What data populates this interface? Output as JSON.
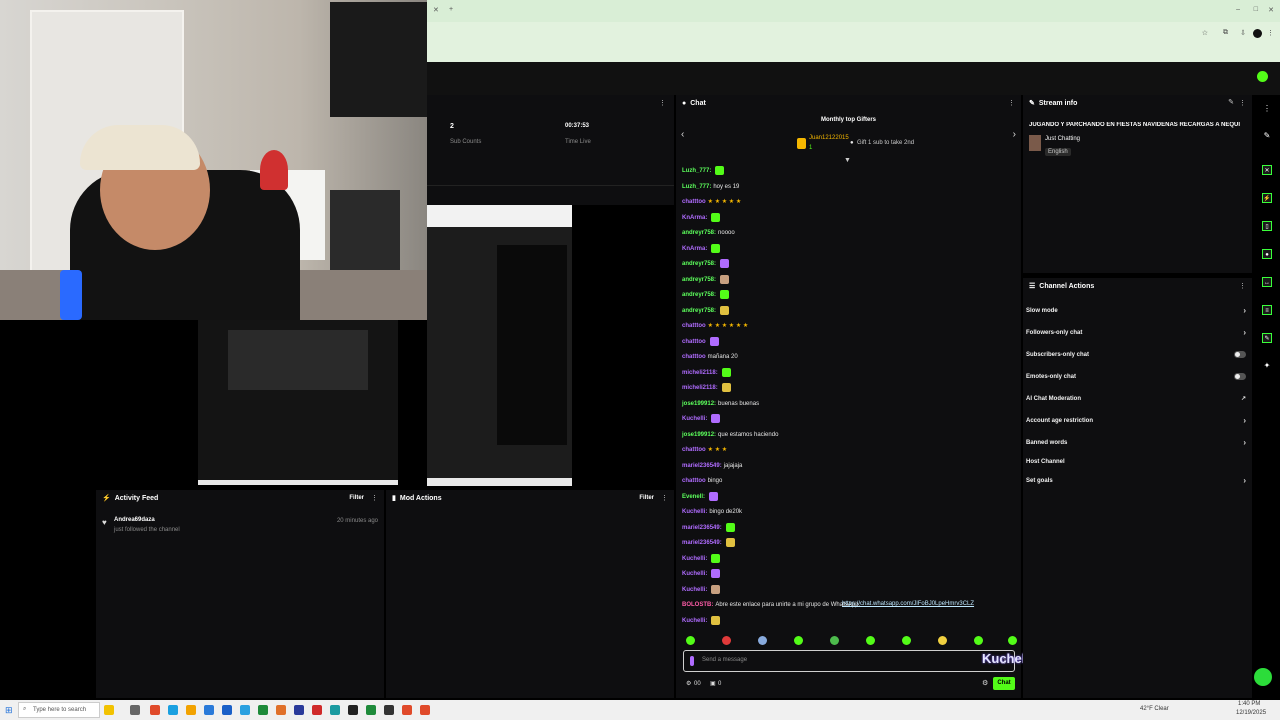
{
  "stream_stats": {
    "sub_count_value": "2",
    "sub_count_label": "Sub Counts",
    "time_value": "00:37:53",
    "time_label": "Time Live"
  },
  "chat": {
    "title": "Chat",
    "top_gifters_title": "Monthly top Gifters",
    "top_gifter_name": "Juan12122015",
    "top_gifter_count": "1",
    "gift_note": "Gift 1 sub to take 2nd",
    "messages": [
      {
        "user": "Luzh_777:",
        "text": "",
        "color": "#5cff5c"
      },
      {
        "user": "Luzh_777:",
        "text": "hoy es 19",
        "color": "#5cff5c"
      },
      {
        "user": "chatttoo",
        "text": "★ ★ ★ ★ ★",
        "color": "#b06cff"
      },
      {
        "user": "KnArma:",
        "text": "",
        "color": "#b06cff"
      },
      {
        "user": "andreyr758:",
        "text": "noooo",
        "color": "#5cff5c"
      },
      {
        "user": "KnArma:",
        "text": "",
        "color": "#b06cff"
      },
      {
        "user": "andreyr758:",
        "text": "",
        "color": "#5cff5c"
      },
      {
        "user": "andreyr758:",
        "text": "",
        "color": "#5cff5c"
      },
      {
        "user": "andreyr758:",
        "text": "",
        "color": "#5cff5c"
      },
      {
        "user": "andreyr758:",
        "text": "",
        "color": "#5cff5c"
      },
      {
        "user": "chatttoo",
        "text": "★ ★ ★ ★ ★ ★",
        "color": "#b06cff"
      },
      {
        "user": "chatttoo",
        "text": "",
        "color": "#b06cff"
      },
      {
        "user": "chatttoo",
        "text": "mañana 20",
        "color": "#b06cff"
      },
      {
        "user": "micheli2118:",
        "text": "",
        "color": "#b06cff"
      },
      {
        "user": "micheli2118:",
        "text": "",
        "color": "#b06cff"
      },
      {
        "user": "jose199912:",
        "text": "buenas buenas",
        "color": "#5cff5c"
      },
      {
        "user": "Kuchelli:",
        "text": "",
        "color": "#b06cff"
      },
      {
        "user": "jose199912:",
        "text": "que estamos haciendo",
        "color": "#5cff5c"
      },
      {
        "user": "chatttoo",
        "text": "★ ★ ★",
        "color": "#b06cff"
      },
      {
        "user": "mariel236549:",
        "text": "jajajaja",
        "color": "#b06cff"
      },
      {
        "user": "chatttoo",
        "text": "bingo",
        "color": "#b06cff"
      },
      {
        "user": "Evenell:",
        "text": "",
        "color": "#5cff5c"
      },
      {
        "user": "Kuchelli:",
        "text": "bingo de20k",
        "color": "#b06cff"
      },
      {
        "user": "mariel236549:",
        "text": "",
        "color": "#b06cff"
      },
      {
        "user": "mariel236549:",
        "text": "",
        "color": "#b06cff"
      },
      {
        "user": "Kuchelli:",
        "text": "",
        "color": "#b06cff"
      },
      {
        "user": "Kuchelli:",
        "text": "",
        "color": "#b06cff"
      },
      {
        "user": "Kuchelli:",
        "text": "",
        "color": "#b06cff"
      },
      {
        "user": "BOLOSTB:",
        "text": "Abre este enlace para unirte a mi grupo de WhatsApp:",
        "color": "#ff5ca8"
      },
      {
        "user": "Kuchelli:",
        "text": "",
        "color": "#b06cff"
      }
    ],
    "whatsapp_link": "https://chat.whatsapp.com/JlFoBJ0LpeHmrv3CLZ",
    "input_placeholder": "Send a message",
    "overlay_name": "Kuchelli",
    "points_a": "00",
    "points_b": "0",
    "send_label": "Chat"
  },
  "stream_info": {
    "title": "Stream info",
    "stream_title": "JUGANDO Y PARCHANDO EN FIESTAS NAVIDEÑAS RECARGAS A NEQUI",
    "category": "Just Chatting",
    "language": "English"
  },
  "channel_actions": {
    "title": "Channel Actions",
    "items": [
      "Slow mode",
      "Followers-only chat",
      "Subscribers-only chat",
      "Emotes-only chat",
      "AI Chat Moderation",
      "Account age restriction",
      "Banned words",
      "Host Channel",
      "Set goals"
    ]
  },
  "activity_feed": {
    "title": "Activity Feed",
    "filter_label": "Filter",
    "user": "Andrea69daza",
    "event": "just followed the channel",
    "time": "20 minutes ago"
  },
  "mod_actions": {
    "title": "Mod Actions",
    "filter_label": "Filter"
  },
  "taskbar": {
    "search_placeholder": "Type here to search",
    "weather": "42°F Clear",
    "time": "1:40 PM",
    "date": "12/19/2025"
  },
  "colors": {
    "accent": "#53fc18",
    "panel": "#0e0e10"
  }
}
